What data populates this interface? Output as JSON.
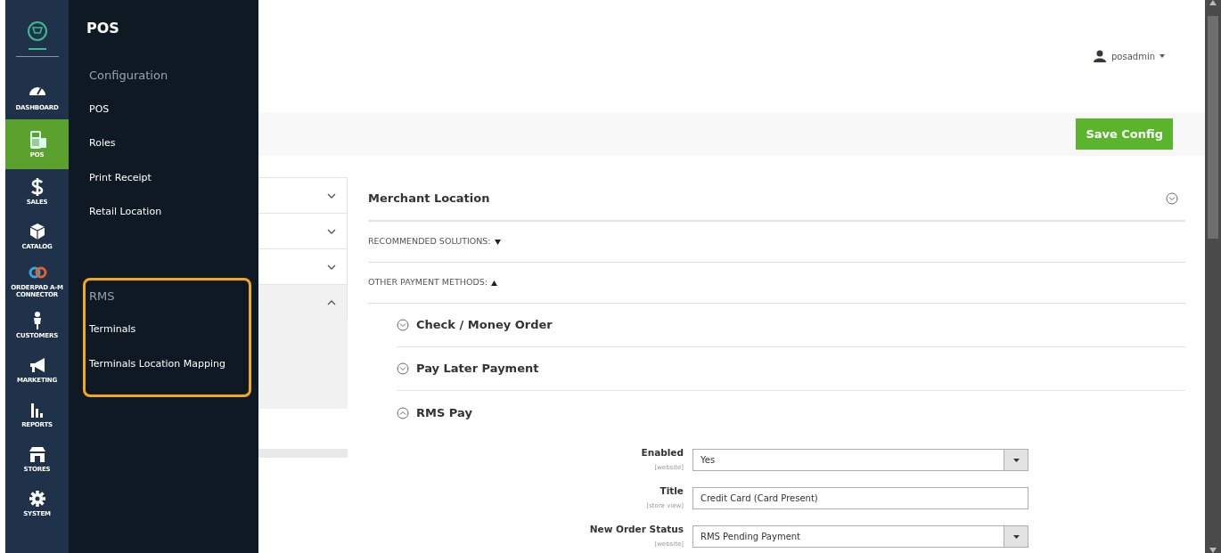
{
  "nav": {
    "items": [
      {
        "label": "DASHBOARD",
        "selected": false
      },
      {
        "label": "POS",
        "selected": true
      },
      {
        "label": "SALES",
        "selected": false
      },
      {
        "label": "CATALOG",
        "selected": false
      },
      {
        "label": "ORDERPAD A-M CONNECTOR",
        "selected": false
      },
      {
        "label": "CUSTOMERS",
        "selected": false
      },
      {
        "label": "MARKETING",
        "selected": false
      },
      {
        "label": "REPORTS",
        "selected": false
      },
      {
        "label": "STORES",
        "selected": false
      },
      {
        "label": "SYSTEM",
        "selected": false
      }
    ]
  },
  "flyout": {
    "title": "POS",
    "groups": [
      {
        "heading": "Configuration",
        "highlighted": false,
        "items": [
          "POS",
          "Roles",
          "Print Receipt",
          "Retail Location"
        ]
      },
      {
        "heading": "RMS",
        "highlighted": true,
        "items": [
          "Terminals",
          "Terminals Location Mapping"
        ]
      }
    ]
  },
  "header": {
    "user": "posadmin"
  },
  "actions": {
    "save_button": "Save Config"
  },
  "config_tabs": [
    {
      "expanded": false
    },
    {
      "expanded": false
    },
    {
      "expanded": false
    },
    {
      "expanded": true
    }
  ],
  "section": {
    "title": "Merchant Location",
    "expanded": false,
    "groups": [
      {
        "label": "RECOMMENDED SOLUTIONS:",
        "expanded": false
      },
      {
        "label": "OTHER PAYMENT METHODS:",
        "expanded": true
      }
    ],
    "methods": [
      {
        "title": "Check / Money Order",
        "expanded": false
      },
      {
        "title": "Pay Later Payment",
        "expanded": false
      },
      {
        "title": "RMS Pay",
        "expanded": true
      }
    ],
    "fields": [
      {
        "kind": "select",
        "label": "Enabled",
        "scope": "[website]",
        "value": "Yes"
      },
      {
        "kind": "text",
        "label": "Title",
        "scope": "[store view]",
        "value": "Credit Card (Card Present)"
      },
      {
        "kind": "select",
        "label": "New Order Status",
        "scope": "[website]",
        "value": "RMS Pending Payment"
      }
    ]
  }
}
